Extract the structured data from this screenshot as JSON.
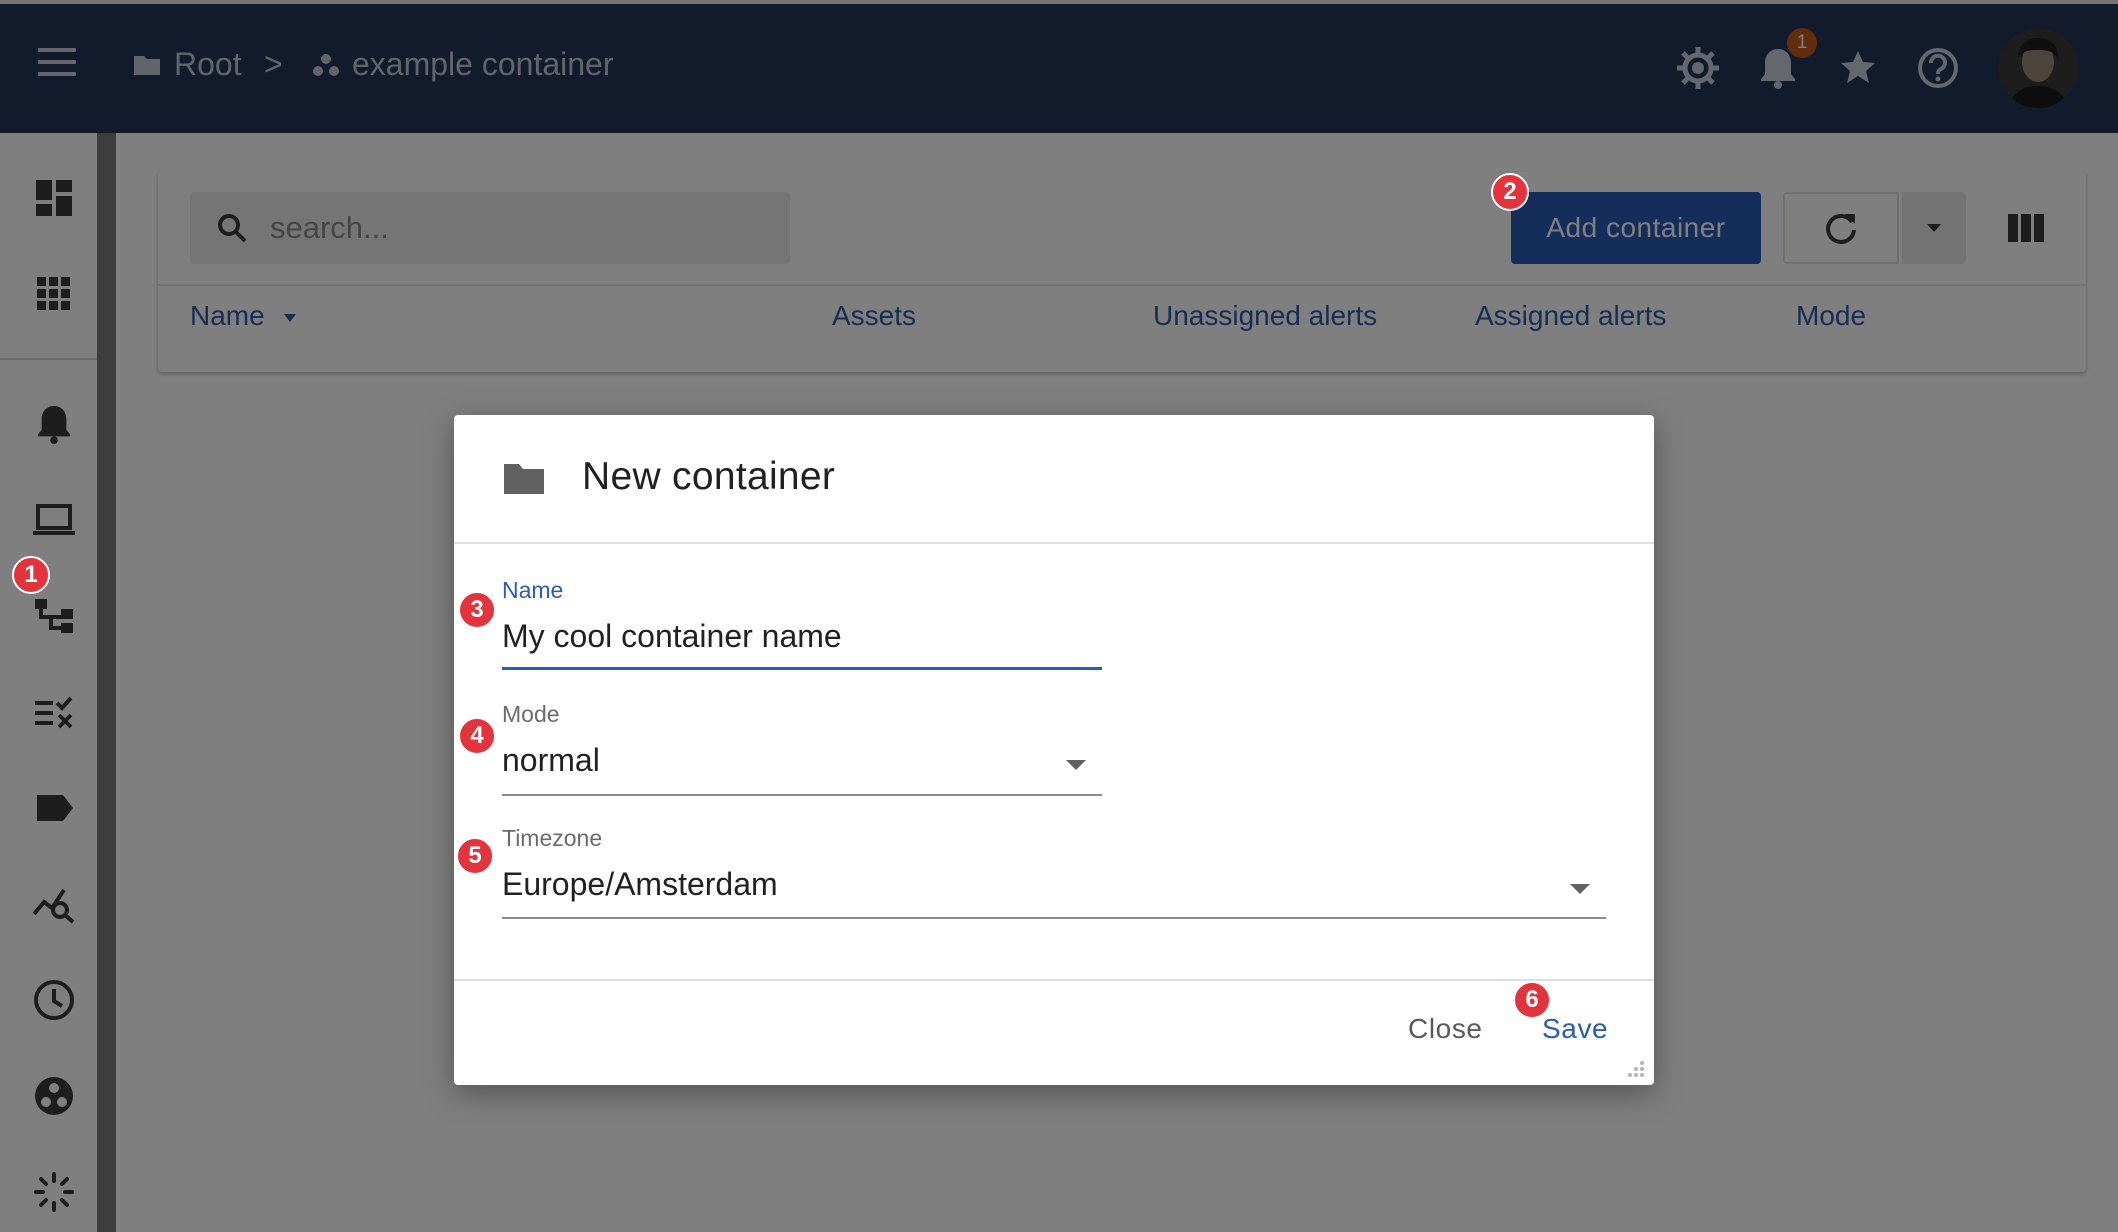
{
  "breadcrumb": {
    "root_label": "Root",
    "separator": ">",
    "current_label": "example container"
  },
  "header": {
    "notification_count": "1"
  },
  "search": {
    "placeholder": "search..."
  },
  "toolbar": {
    "add_label": "Add container"
  },
  "table": {
    "columns": [
      "Name",
      "Assets",
      "Unassigned alerts",
      "Assigned alerts",
      "Mode"
    ]
  },
  "dialog": {
    "title": "New container",
    "fields": {
      "name": {
        "label": "Name",
        "value": "My cool container name"
      },
      "mode": {
        "label": "Mode",
        "value": "normal"
      },
      "timezone": {
        "label": "Timezone",
        "value": "Europe/Amsterdam"
      }
    },
    "close_label": "Close",
    "save_label": "Save"
  },
  "markers": [
    "1",
    "2",
    "3",
    "4",
    "5",
    "6"
  ],
  "colors": {
    "header_bg": "#243656",
    "accent": "#2a5bb6",
    "marker": "#e3333c",
    "notification_badge": "#c25a1b"
  }
}
